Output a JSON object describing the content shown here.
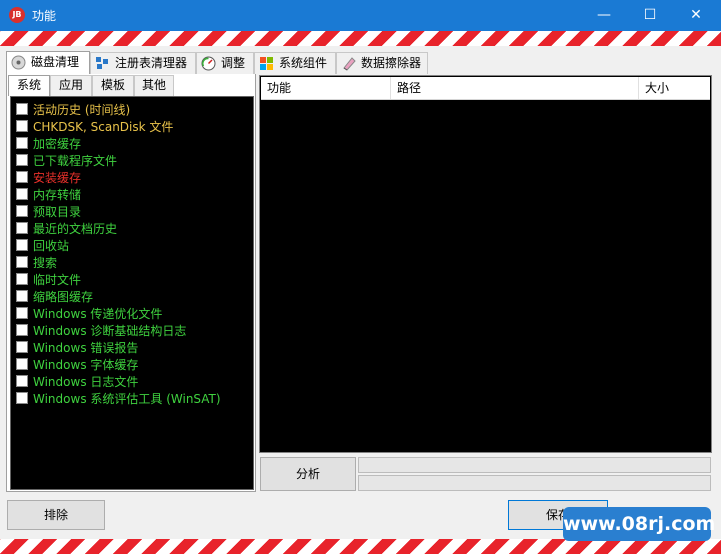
{
  "window": {
    "title": "功能",
    "app_icon": "JB"
  },
  "controls": {
    "minimize": "—",
    "maximize": "☐",
    "close": "✕"
  },
  "main_tabs": [
    {
      "label": "磁盘清理",
      "icon": "disk-icon"
    },
    {
      "label": "注册表清理器",
      "icon": "registry-icon"
    },
    {
      "label": "调整",
      "icon": "gauge-icon"
    },
    {
      "label": "系统组件",
      "icon": "windows-icon"
    },
    {
      "label": "数据擦除器",
      "icon": "eraser-icon"
    }
  ],
  "sub_tabs": [
    "系统",
    "应用",
    "模板",
    "其他"
  ],
  "items": [
    {
      "label": "活动历史 (时间线)",
      "color": "#e8c24a"
    },
    {
      "label": "CHKDSK, ScanDisk 文件",
      "color": "#e8c24a"
    },
    {
      "label": "加密缓存",
      "color": "#3fd23f"
    },
    {
      "label": "已下载程序文件",
      "color": "#3fd23f"
    },
    {
      "label": "安装缓存",
      "color": "#e8302a"
    },
    {
      "label": "内存转储",
      "color": "#3fd23f"
    },
    {
      "label": "预取目录",
      "color": "#3fd23f"
    },
    {
      "label": "最近的文档历史",
      "color": "#3fd23f"
    },
    {
      "label": "回收站",
      "color": "#3fd23f"
    },
    {
      "label": "搜索",
      "color": "#3fd23f"
    },
    {
      "label": "临时文件",
      "color": "#3fd23f"
    },
    {
      "label": "缩略图缓存",
      "color": "#3fd23f"
    },
    {
      "label": "Windows 传递优化文件",
      "color": "#3fd23f"
    },
    {
      "label": "Windows 诊断基础结构日志",
      "color": "#3fd23f"
    },
    {
      "label": "Windows 错误报告",
      "color": "#3fd23f"
    },
    {
      "label": "Windows 字体缓存",
      "color": "#3fd23f"
    },
    {
      "label": "Windows 日志文件",
      "color": "#3fd23f"
    },
    {
      "label": "Windows 系统评估工具 (WinSAT)",
      "color": "#3fd23f"
    }
  ],
  "columns": [
    "功能",
    "路径",
    "大小"
  ],
  "buttons": {
    "analyze": "分析",
    "exclude": "排除",
    "save": "保存"
  },
  "watermark": "www.08rj.com"
}
